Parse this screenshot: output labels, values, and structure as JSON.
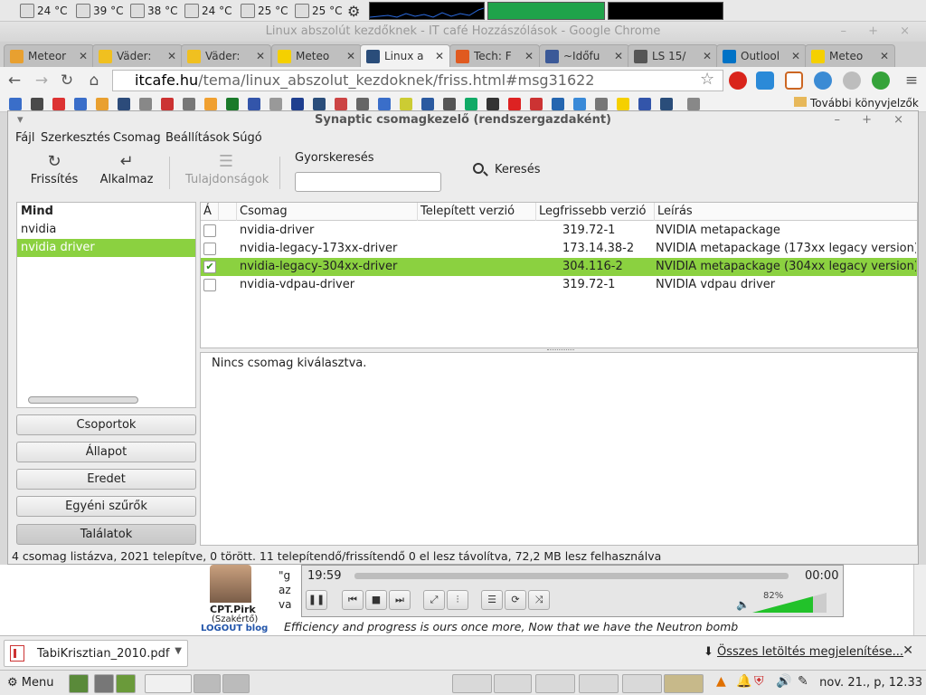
{
  "top_panel": {
    "temps": [
      "24 °C",
      "39 °C",
      "38 °C",
      "24 °C",
      "25 °C",
      "25 °C"
    ]
  },
  "browser": {
    "window_title": "Linux abszolút kezdőknek - IT café Hozzászólások - Google Chrome",
    "tabs": [
      {
        "label": "Meteor",
        "color": "#e8a030"
      },
      {
        "label": "Väder:",
        "color": "#f0c020"
      },
      {
        "label": "Väder:",
        "color": "#f0c020"
      },
      {
        "label": "Meteo",
        "color": "#f5d000"
      },
      {
        "label": "Linux a",
        "color": "#2a4d7a"
      },
      {
        "label": "Tech: F",
        "color": "#e05a20"
      },
      {
        "label": "~Időfu",
        "color": "#3b5998"
      },
      {
        "label": "LS 15/",
        "color": "#555555"
      },
      {
        "label": "Outlool",
        "color": "#0072c6"
      },
      {
        "label": "Meteo",
        "color": "#f5d000"
      }
    ],
    "url_domain": "itcafe.hu",
    "url_path": "/tema/linux_abszolut_kezdoknek/friss.html#msg31622",
    "bookmarks_more": "További könyvjelzők"
  },
  "synaptic": {
    "title": "Synaptic csomagkezelő  (rendszergazdaként)",
    "menu": [
      "Fájl",
      "Szerkesztés",
      "Csomag",
      "Beállítások",
      "Súgó"
    ],
    "toolbar": {
      "refresh": "Frissítés",
      "apply": "Alkalmaz",
      "properties": "Tulajdonságok",
      "quick_search_label": "Gyorskeresés",
      "quick_search_value": "",
      "search": "Keresés"
    },
    "filters": [
      {
        "label": "Mind",
        "style": "bold"
      },
      {
        "label": "nvidia",
        "style": "normal"
      },
      {
        "label": "nvidia driver",
        "style": "selected"
      }
    ],
    "filter_buttons": [
      "Csoportok",
      "Állapot",
      "Eredet",
      "Egyéni szűrők",
      "Találatok"
    ],
    "columns": [
      "Á",
      "",
      "Csomag",
      "Telepített verzió",
      "Legfrissebb verzió",
      "Leírás"
    ],
    "packages": [
      {
        "checked": "",
        "name": "nvidia-driver",
        "installed": "",
        "latest": "319.72-1",
        "desc": "NVIDIA metapackage"
      },
      {
        "checked": "",
        "name": "nvidia-legacy-173xx-driver",
        "installed": "",
        "latest": "173.14.38-2",
        "desc": "NVIDIA metapackage (173xx legacy version)"
      },
      {
        "checked": "✔",
        "name": "nvidia-legacy-304xx-driver",
        "installed": "",
        "latest": "304.116-2",
        "desc": "NVIDIA metapackage (304xx legacy version)"
      },
      {
        "checked": "",
        "name": "nvidia-vdpau-driver",
        "installed": "",
        "latest": "319.72-1",
        "desc": "NVIDIA vdpau driver"
      }
    ],
    "detail": "Nincs csomag kiválasztva.",
    "status": "4 csomag listázva, 2021 telepítve, 0 törött. 11 telepítendő/frissítendő 0 el lesz távolítva, 72,2 MB lesz felhasználva"
  },
  "page": {
    "user_name": "CPT.Pirk",
    "user_rank": "(Szakértő)",
    "user_links": "LOGOUT blog",
    "quote": "Efficiency and progress is ours once more, Now that we have the Neutron bomb",
    "fragments": [
      "\"g",
      "az",
      "va"
    ]
  },
  "player": {
    "time": "19:59",
    "end_time": "00:00",
    "volume": "82%",
    "volume_level": 0.82
  },
  "downloads": {
    "file": "TabiKrisztian_2010.pdf",
    "show_all": "Összes letöltés megjelenítése..."
  },
  "bottom_panel": {
    "menu_label": "Menu",
    "clock": "nov. 21., p, 12.33"
  }
}
